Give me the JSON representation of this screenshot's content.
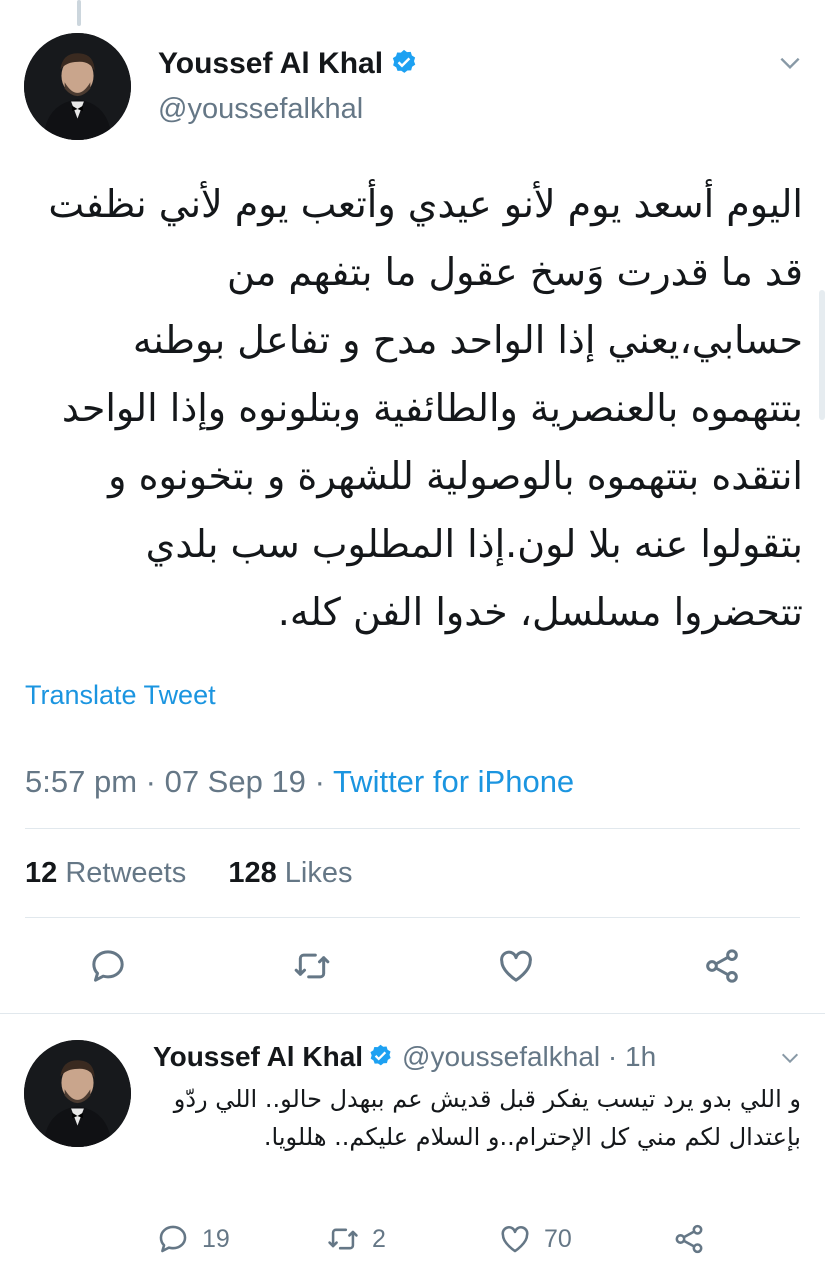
{
  "tweet": {
    "author_name": "Youssef Al Khal",
    "handle": "@youssefalkhal",
    "text": "اليوم أسعد يوم لأنو عيدي وأتعب يوم لأني نظفت قد ما قدرت وَسخ عقول ما بتفهم من حسابي،يعني إذا الواحد مدح و تفاعل بوطنه بتتهموه بالعنصرية والطائفية وبتلونوه وإذا الواحد انتقده بتتهموه بالوصولية للشهرة و بتخونوه و بتقولوا عنه بلا لون.إذا المطلوب سب بلدي تتحضروا مسلسل، خدوا الفن كله.",
    "translate_label": "Translate Tweet",
    "time": "5:57 pm",
    "date": "07 Sep 19",
    "source": "Twitter for iPhone",
    "retweets_count": "12",
    "retweets_label": "Retweets",
    "likes_count": "128",
    "likes_label": "Likes"
  },
  "reply": {
    "author_name": "Youssef Al Khal",
    "handle_time": "@youssefalkhal · 1h",
    "text": "و اللي بدو يرد تيسب يفكر قبل قديش عم ببهدل حالو.. اللي ردّو بإعتدال لكم مني كل الإحترام..و السلام عليكم.. هللويا.",
    "reply_count": "19",
    "retweet_count": "2",
    "like_count": "70"
  },
  "colors": {
    "accent": "#1b95e0",
    "verified": "#1da1f2",
    "secondary_text": "#657786",
    "icon": "#657786"
  },
  "icons": [
    "verified-badge-icon",
    "chevron-down-icon",
    "reply-icon",
    "retweet-icon",
    "like-icon",
    "share-icon"
  ]
}
